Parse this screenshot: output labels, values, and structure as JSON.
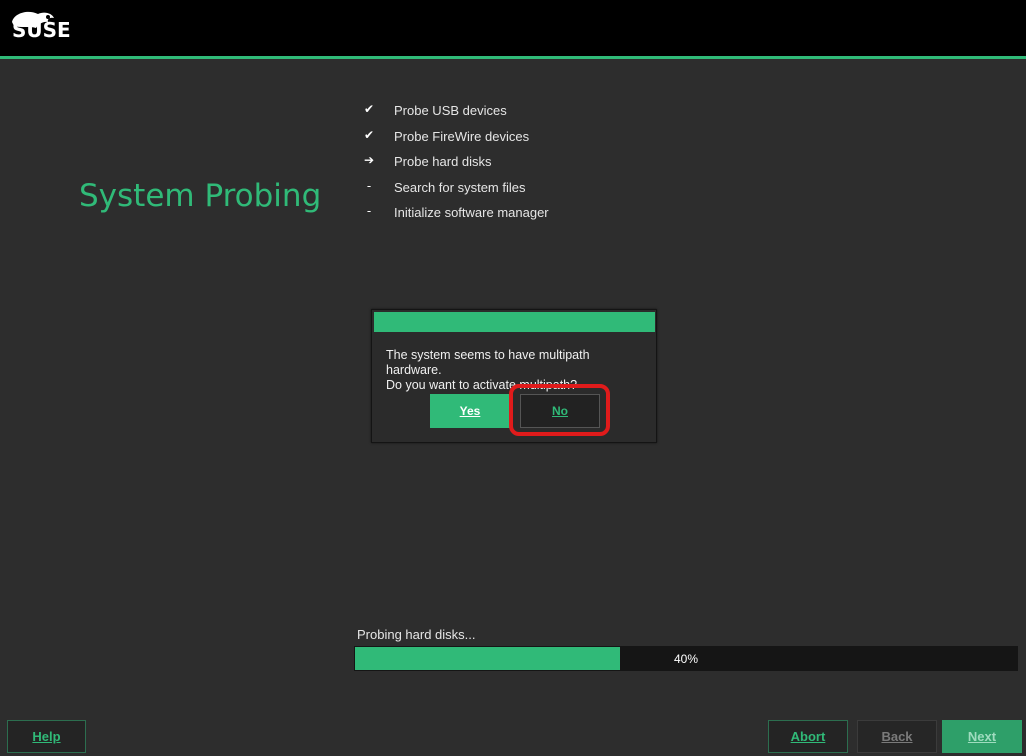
{
  "header": {
    "logo_text": "SUSE",
    "colors": {
      "accent": "#30ba78",
      "background": "#2d2d2d",
      "topbar": "#000000"
    }
  },
  "page": {
    "title": "System Probing"
  },
  "steps": [
    {
      "mark": "✔",
      "label": "Probe USB devices",
      "status": "done"
    },
    {
      "mark": "✔",
      "label": "Probe FireWire devices",
      "status": "done"
    },
    {
      "mark": "➔",
      "label": "Probe hard disks",
      "status": "current"
    },
    {
      "mark": "-",
      "label": "Search for system files",
      "status": "pending"
    },
    {
      "mark": "-",
      "label": "Initialize software manager",
      "status": "pending"
    }
  ],
  "dialog": {
    "message_line1": "The system seems to have multipath hardware.",
    "message_line2": "Do you want to activate multipath?",
    "yes_label": "Yes",
    "no_label": "No"
  },
  "progress": {
    "label": "Probing hard disks...",
    "percent_text": "40%",
    "fraction": 0.4
  },
  "footer": {
    "help_label": "Help",
    "abort_label": "Abort",
    "back_label": "Back",
    "next_label": "Next"
  }
}
